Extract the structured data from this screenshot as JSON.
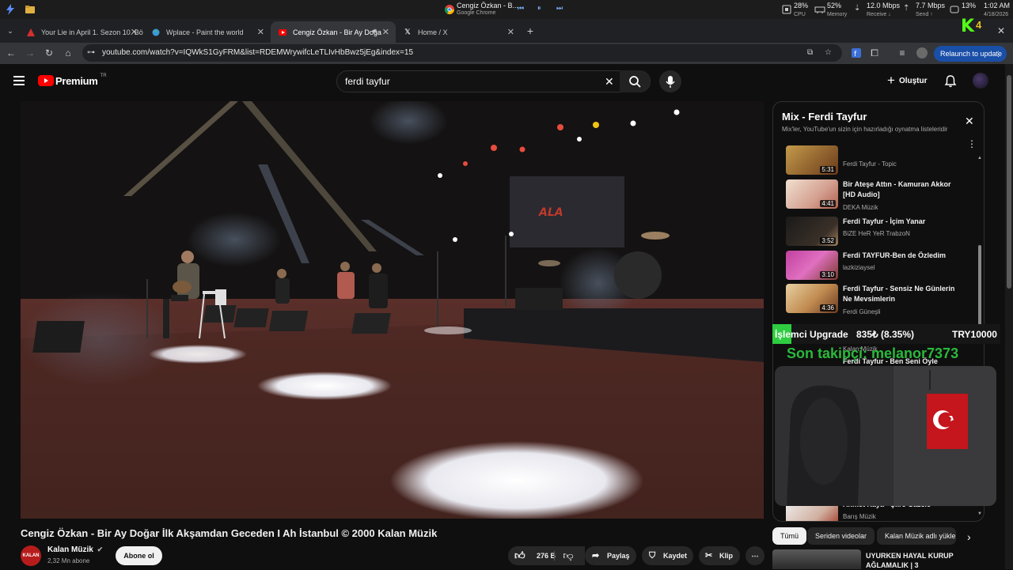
{
  "taskbar": {
    "media_title": "Cengiz Özkan - B...",
    "media_app": "Google Chrome",
    "cpu_value": "28%",
    "cpu_label": "CPU",
    "memory_value": "52%",
    "memory_label": "Memory",
    "receive_value": "12.0 Mbps",
    "receive_label": "Receive ↓",
    "send_value": "7.7 Mbps",
    "send_label": "Send ↑",
    "battery_value": "13%",
    "battery_label": "",
    "time": "1:02 AM",
    "date": "4/18/2026",
    "kick_badge": "4"
  },
  "tabs": [
    {
      "label": "Your Lie in April 1. Sezon 10. Bö",
      "icon": "anime-site-icon"
    },
    {
      "label": "Wplace - Paint the world",
      "icon": "globe-icon"
    },
    {
      "label": "Cengiz Özkan - Bir Ay Doğa",
      "icon": "youtube-icon"
    },
    {
      "label": "Home / X",
      "icon": "x-icon"
    }
  ],
  "address": {
    "url": "youtube.com/watch?v=IQWkS1GyFRM&list=RDEMWrywifcLeTLIvHbBwz5jEg&index=15",
    "relaunch_label": "Relaunch to update"
  },
  "youtube": {
    "logo": "Premium",
    "region": "TR",
    "search_value": "ferdi tayfur",
    "create_label": "Oluştur"
  },
  "mix": {
    "title": "Mix - Ferdi Tayfur",
    "subtitle": "Mix'ler, YouTube'un sizin için hazırladığı oynatma listeleridir",
    "items": [
      {
        "title": "",
        "channel": "Ferdi Tayfur - Topic",
        "duration": "5:31"
      },
      {
        "title": "Bir Ateşe Attın - Kamuran Akkor [HD Audio]",
        "channel": "DEKA Müzik",
        "duration": "4:41"
      },
      {
        "title": "Ferdi Tayfur - İçim Yanar",
        "channel": "BiZE HeR YeR TrabzoN",
        "duration": "3:52"
      },
      {
        "title": "Ferdi TAYFUR-Ben de Özledim",
        "channel": "lazkiziaysel",
        "duration": "3:10"
      },
      {
        "title": "Ferdi Tayfur - Sensiz Ne Günlerin Ne Mevsimlerin",
        "channel": "Ferdi Güneşli",
        "duration": "4:36"
      },
      {
        "title": "Ahmet Kaya - Şiire Gazele",
        "channel": "Barış Müzik",
        "duration": ""
      }
    ],
    "hidden_item_channel": "Kalan Müzik",
    "hidden_item_title": "Ferdi Tayfur - Ben Seni Öyle"
  },
  "overlay": {
    "upgrade_label": "İşlemci Upgrade",
    "upgrade_progress": "835₺ (8.35%)",
    "upgrade_goal": "TRY10000",
    "follower_text": "Son takipçi: melanor7373"
  },
  "video": {
    "title": "Cengiz Özkan - Bir Ay Doğar İlk Akşamdan Geceden I Ah İstanbul © 2000 Kalan Müzik",
    "stage_sign": "ALA"
  },
  "channel": {
    "name": "Kalan Müzik",
    "subscribers": "2,32 Mn abone",
    "avatar_text": "KALAN",
    "subscribe_label": "Abone ol"
  },
  "actions": {
    "likes": "276 B",
    "share": "Paylaş",
    "save": "Kaydet",
    "clip": "Klip"
  },
  "chips": [
    "Tümü",
    "Seriden videolar",
    "Kalan Müzik adlı yükle"
  ],
  "recommendation": {
    "title_line1": "UYURKEN HAYAL KURUP",
    "title_line2": "AĞLAMALIK | 3"
  },
  "colors": {
    "youtube_red": "#ff0000",
    "relaunch_blue": "#1a4fa8",
    "overlay_green": "#2ecc40",
    "kick_green": "#53fc18"
  }
}
